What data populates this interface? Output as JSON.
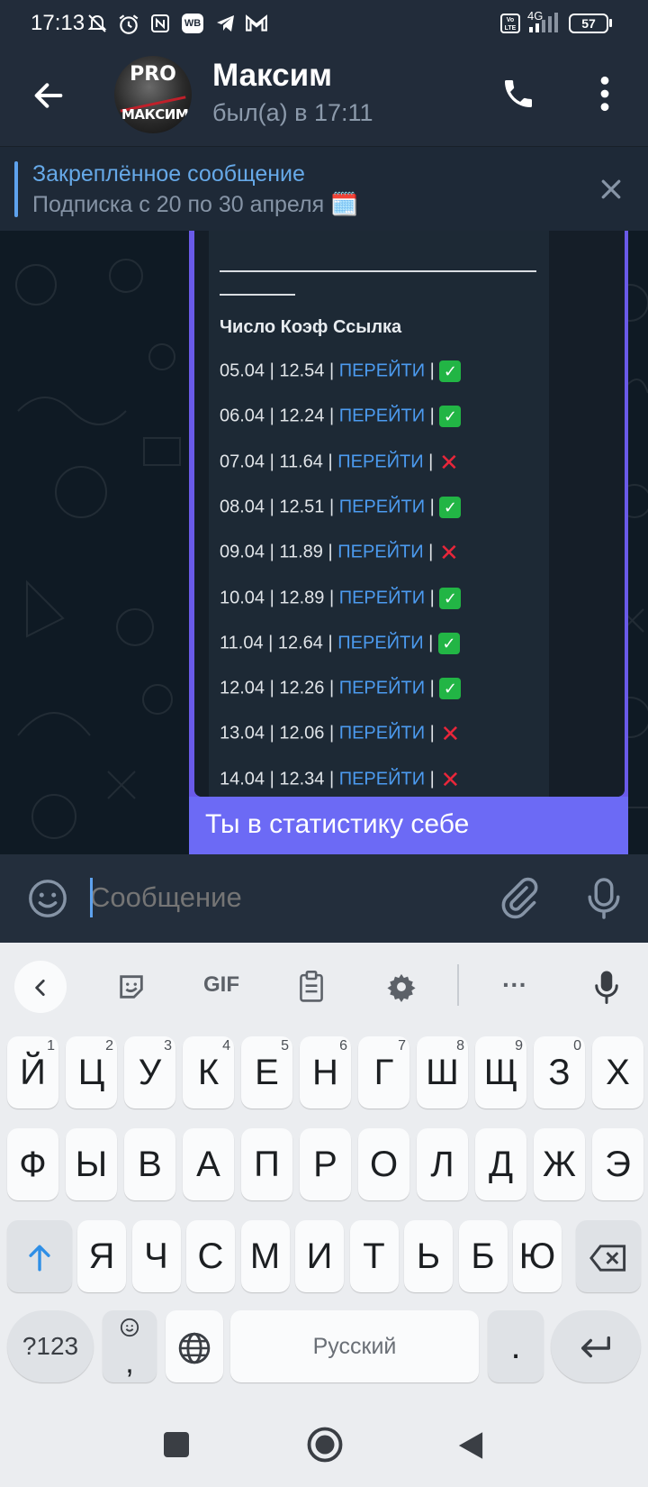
{
  "status": {
    "time": "17:13",
    "network": "4G",
    "volte": "Vo LTE",
    "battery": "57",
    "icons": [
      "mute-icon",
      "alarm-icon",
      "nfc-icon",
      "wb-icon",
      "telegram-icon",
      "gmail-icon"
    ]
  },
  "header": {
    "name": "Максим",
    "last_seen": "был(а) в 17:11",
    "avatar_text": "МАКСИМ",
    "avatar_top_text": "PRO"
  },
  "pinned": {
    "title": "Закреплённое сообщение",
    "text": "Подписка с 20 по 30 апреля 🗓️"
  },
  "message": {
    "table_header": "Число  Коэф  Ссылка",
    "link_label": "ПЕРЕЙТИ",
    "rows": [
      {
        "date": "05.04",
        "coef": "12.54",
        "ok": true
      },
      {
        "date": "06.04",
        "coef": "12.24",
        "ok": true
      },
      {
        "date": "07.04",
        "coef": "11.64",
        "ok": false
      },
      {
        "date": "08.04",
        "coef": "12.51",
        "ok": true
      },
      {
        "date": "09.04",
        "coef": "11.89",
        "ok": false
      },
      {
        "date": "10.04",
        "coef": "12.89",
        "ok": true
      },
      {
        "date": "11.04",
        "coef": "12.64",
        "ok": true
      },
      {
        "date": "12.04",
        "coef": "12.26",
        "ok": true
      },
      {
        "date": "13.04",
        "coef": "12.06",
        "ok": false
      },
      {
        "date": "14.04",
        "coef": "12.34",
        "ok": false
      }
    ],
    "caption": "Ты в статистику себе"
  },
  "composer": {
    "placeholder": "Сообщение"
  },
  "keyboard": {
    "toolbar": [
      "back",
      "sticker",
      "GIF",
      "clipboard",
      "settings",
      "more",
      "mic"
    ],
    "gif_label": "GIF",
    "more_label": "···",
    "row1": [
      {
        "k": "Й",
        "n": "1"
      },
      {
        "k": "Ц",
        "n": "2"
      },
      {
        "k": "У",
        "n": "3"
      },
      {
        "k": "К",
        "n": "4"
      },
      {
        "k": "Е",
        "n": "5"
      },
      {
        "k": "Н",
        "n": "6"
      },
      {
        "k": "Г",
        "n": "7"
      },
      {
        "k": "Ш",
        "n": "8"
      },
      {
        "k": "Щ",
        "n": "9"
      },
      {
        "k": "З",
        "n": "0"
      },
      {
        "k": "Х",
        "n": ""
      }
    ],
    "row2": [
      "Ф",
      "Ы",
      "В",
      "А",
      "П",
      "Р",
      "О",
      "Л",
      "Д",
      "Ж",
      "Э"
    ],
    "row3": [
      "Я",
      "Ч",
      "С",
      "М",
      "И",
      "Т",
      "Ь",
      "Б",
      "Ю"
    ],
    "symbols_label": "?123",
    "comma_label": ",",
    "space_label": "Русский",
    "period_label": "."
  },
  "colors": {
    "accent": "#5ea2ee",
    "caption_bg": "#6c6af5",
    "check_green": "#22b545",
    "cross_red": "#e8263a"
  }
}
